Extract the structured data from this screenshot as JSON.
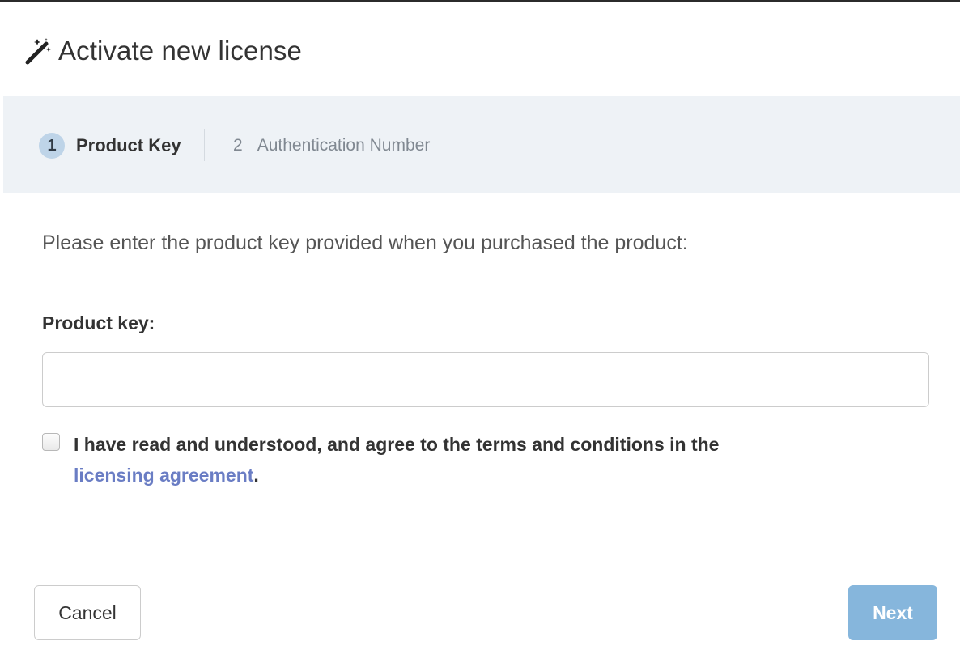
{
  "dialog": {
    "title": "Activate new license",
    "title_icon": "magic-wand-icon"
  },
  "steps": [
    {
      "number": "1",
      "label": "Product Key",
      "active": true
    },
    {
      "number": "2",
      "label": "Authentication Number",
      "active": false
    }
  ],
  "form": {
    "instruction": "Please enter the product key provided when you purchased the product:",
    "product_key_label": "Product key:",
    "product_key_value": "",
    "product_key_placeholder": "",
    "agree_checked": false,
    "agree_text": "I have read and understood, and agree to the terms and conditions in the",
    "agree_link": "licensing agreement",
    "agree_suffix": "."
  },
  "buttons": {
    "cancel": "Cancel",
    "next": "Next"
  },
  "colors": {
    "step_band": "#eef2f6",
    "active_step_circle": "#bed4e8",
    "link": "#6a7dc4",
    "next_button_disabled": "#86b6dc"
  }
}
